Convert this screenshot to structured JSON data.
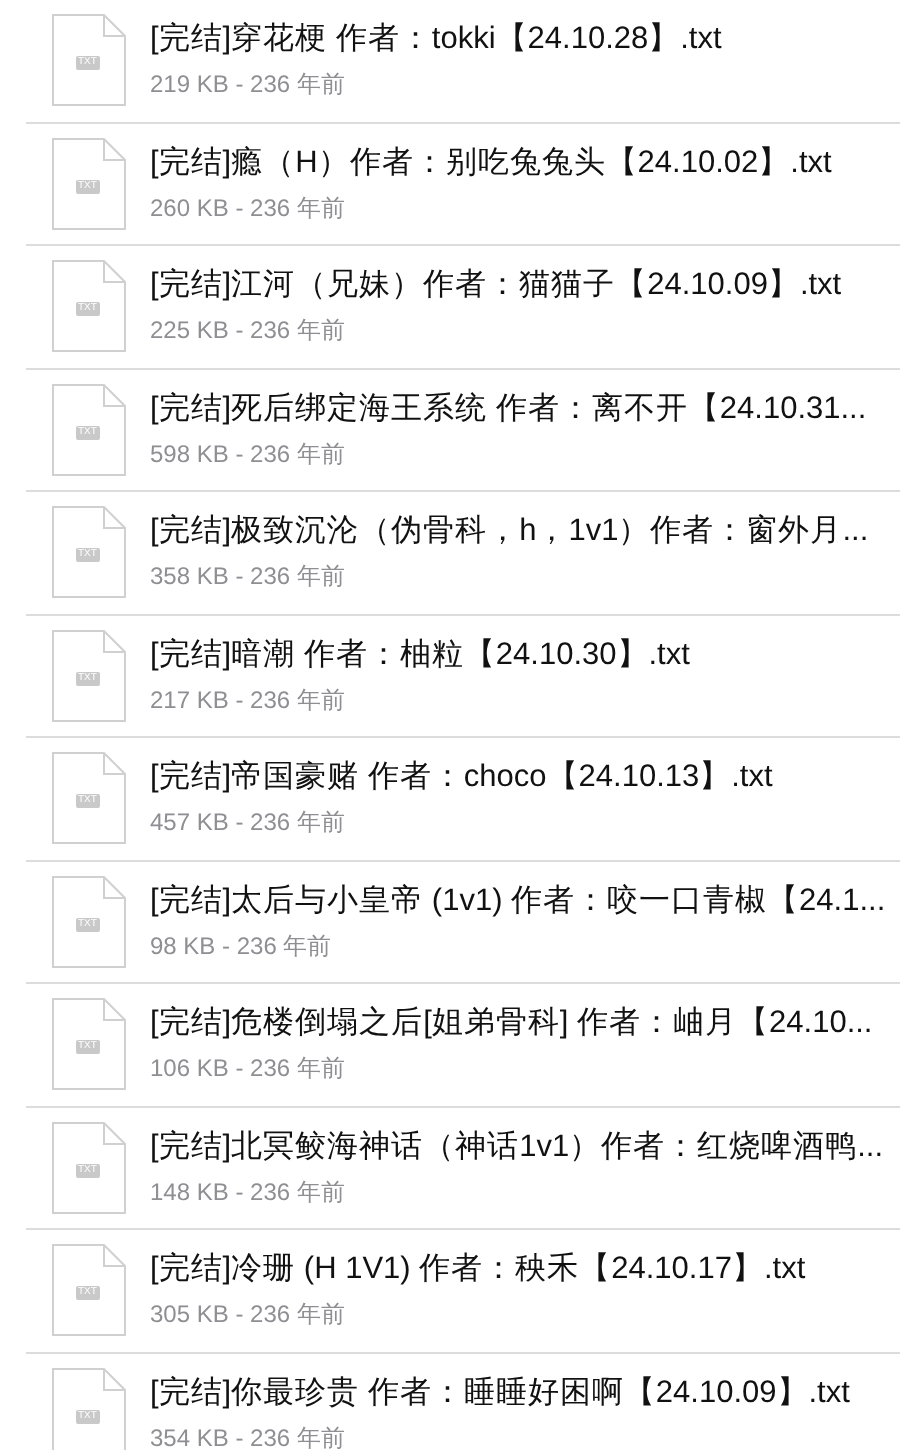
{
  "files": [
    {
      "name": "[完结]穿花梗 作者：tokki【24.10.28】.txt",
      "badge": "TXT",
      "meta": "219 KB - 236 年前"
    },
    {
      "name": "[完结]瘾（H）作者：别吃兔兔头【24.10.02】.txt",
      "badge": "TXT",
      "meta": "260 KB - 236 年前"
    },
    {
      "name": "[完结]江河（兄妹）作者：猫猫子【24.10.09】.txt",
      "badge": "TXT",
      "meta": "225 KB - 236 年前"
    },
    {
      "name": "[完结]死后绑定海王系统 作者：离不开【24.10.31...",
      "badge": "TXT",
      "meta": "598 KB - 236 年前"
    },
    {
      "name": "[完结]极致沉沦（伪骨科，h，1v1）作者：窗外月...",
      "badge": "TXT",
      "meta": "358 KB - 236 年前"
    },
    {
      "name": "[完结]暗潮 作者：柚粒【24.10.30】.txt",
      "badge": "TXT",
      "meta": "217 KB - 236 年前"
    },
    {
      "name": "[完结]帝国豪赌 作者：choco【24.10.13】.txt",
      "badge": "TXT",
      "meta": "457 KB - 236 年前"
    },
    {
      "name": "[完结]太后与小皇帝 (1v1) 作者：咬一口青椒【24.1...",
      "badge": "TXT",
      "meta": "98 KB - 236 年前"
    },
    {
      "name": "[完结]危楼倒塌之后[姐弟骨科] 作者：岫月【24.10...",
      "badge": "TXT",
      "meta": "106 KB - 236 年前"
    },
    {
      "name": "[完结]北冥鲛海神话（神话1v1）作者：红烧啤酒鸭...",
      "badge": "TXT",
      "meta": "148 KB - 236 年前"
    },
    {
      "name": "[完结]冷珊 (H 1V1) 作者：秧禾【24.10.17】.txt",
      "badge": "TXT",
      "meta": "305 KB - 236 年前"
    },
    {
      "name": "[完结]你最珍贵 作者：睡睡好困啊【24.10.09】.txt",
      "badge": "TXT",
      "meta": "354 KB - 236 年前"
    }
  ]
}
